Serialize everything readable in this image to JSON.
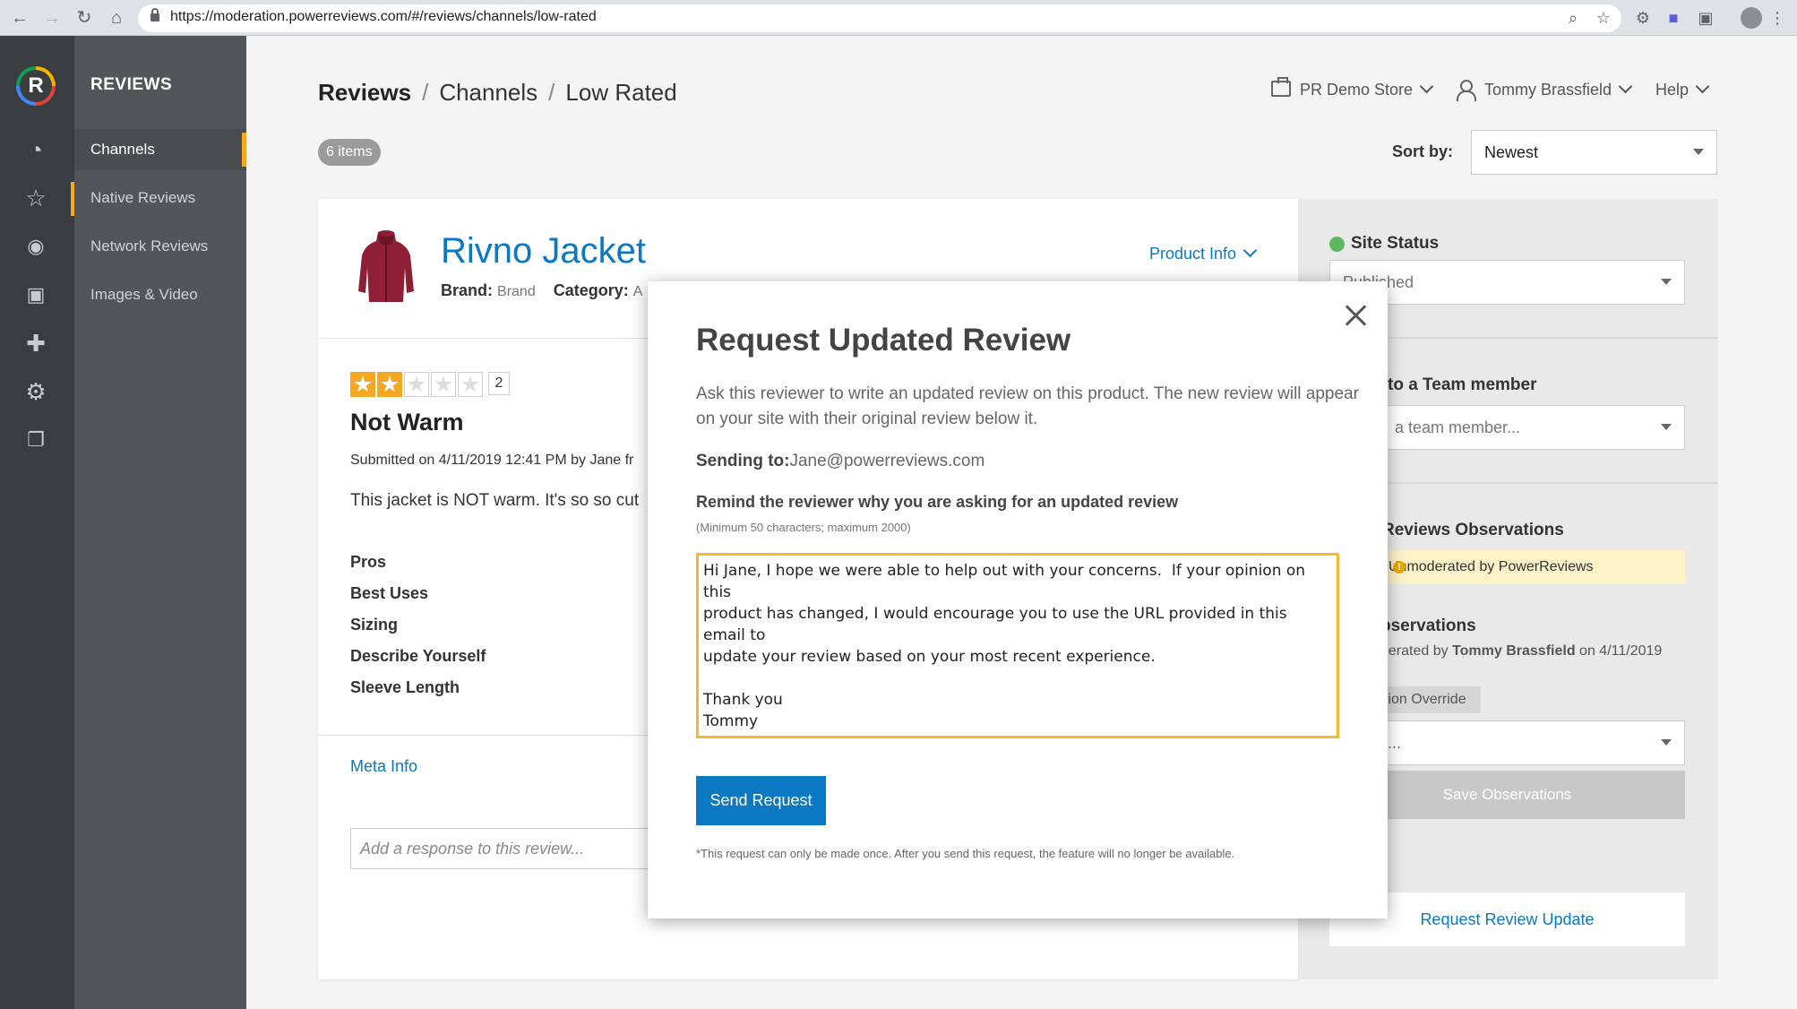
{
  "browser": {
    "url": "https://moderation.powerreviews.com/#/reviews/channels/low-rated"
  },
  "sidebar": {
    "logo_letter": "R",
    "brand": "REVIEWS",
    "items": [
      {
        "label": "Channels"
      },
      {
        "label": "Native Reviews"
      },
      {
        "label": "Network Reviews"
      },
      {
        "label": "Images & Video"
      }
    ]
  },
  "header": {
    "breadcrumb": [
      "Reviews",
      "Channels",
      "Low Rated"
    ],
    "separator": "/",
    "store": "PR Demo Store",
    "user": "Tommy Brassfield",
    "help": "Help",
    "items_count": "6 items",
    "sort_label": "Sort by:",
    "sort_value": "Newest"
  },
  "review": {
    "product_name": "Rivno Jacket",
    "brand_label": "Brand:",
    "brand_value": "Brand",
    "category_label": "Category:",
    "category_value": "A",
    "product_info": "Product Info",
    "rating": 2,
    "rating_max": 5,
    "rating_label": "2",
    "title": "Not Warm",
    "submitted": "Submitted on 4/11/2019 12:41 PM by Jane fr",
    "body": "This jacket is NOT warm. It's so so cut",
    "attributes": [
      "Pros",
      "Best Uses",
      "Sizing",
      "Describe Yourself",
      "Sleeve Length"
    ],
    "meta_info": "Meta Info",
    "response_placeholder": "Add a response to this review..."
  },
  "right_panel": {
    "site_status_label": "Site Status",
    "site_status_value": "Published",
    "assign_label": "to a Team member",
    "assign_placeholder": "a team member...",
    "reviews_obs_label": "Reviews Observations",
    "unmoderated": "Unmoderated by PowerReviews",
    "observations_label": "bservations",
    "observations_line_prefix": "derated by",
    "observations_user": "Tommy Brassfield",
    "observations_date": "on 4/11/2019",
    "override_chip": "tion Override",
    "obs_select": "...",
    "save_observations": "Save Observations",
    "request_review_update": "Request Review Update",
    "status_color": "#5cb85c"
  },
  "modal": {
    "title": "Request Updated Review",
    "description": "Ask this reviewer to write an updated review on this product. The new review will appear on your site with their original review below it.",
    "sending_label": "Sending to:",
    "sending_email": "Jane@powerreviews.com",
    "remind_label": "Remind the reviewer why you are asking for an updated review",
    "remind_hint": "(Minimum 50 characters; maximum 2000)",
    "message": "Hi Jane, I hope we were able to help out with your concerns.  If your opinion on this\nproduct has changed, I would encourage you to use the URL provided in this email to\nupdate your review based on your most recent experience.\n\nThank you\nTommy",
    "send_button": "Send Request",
    "footnote": "*This request can only be made once. After you send this request, the feature will no longer be available.",
    "accent_color": "#0a78c2",
    "focus_color": "#f7b731"
  }
}
